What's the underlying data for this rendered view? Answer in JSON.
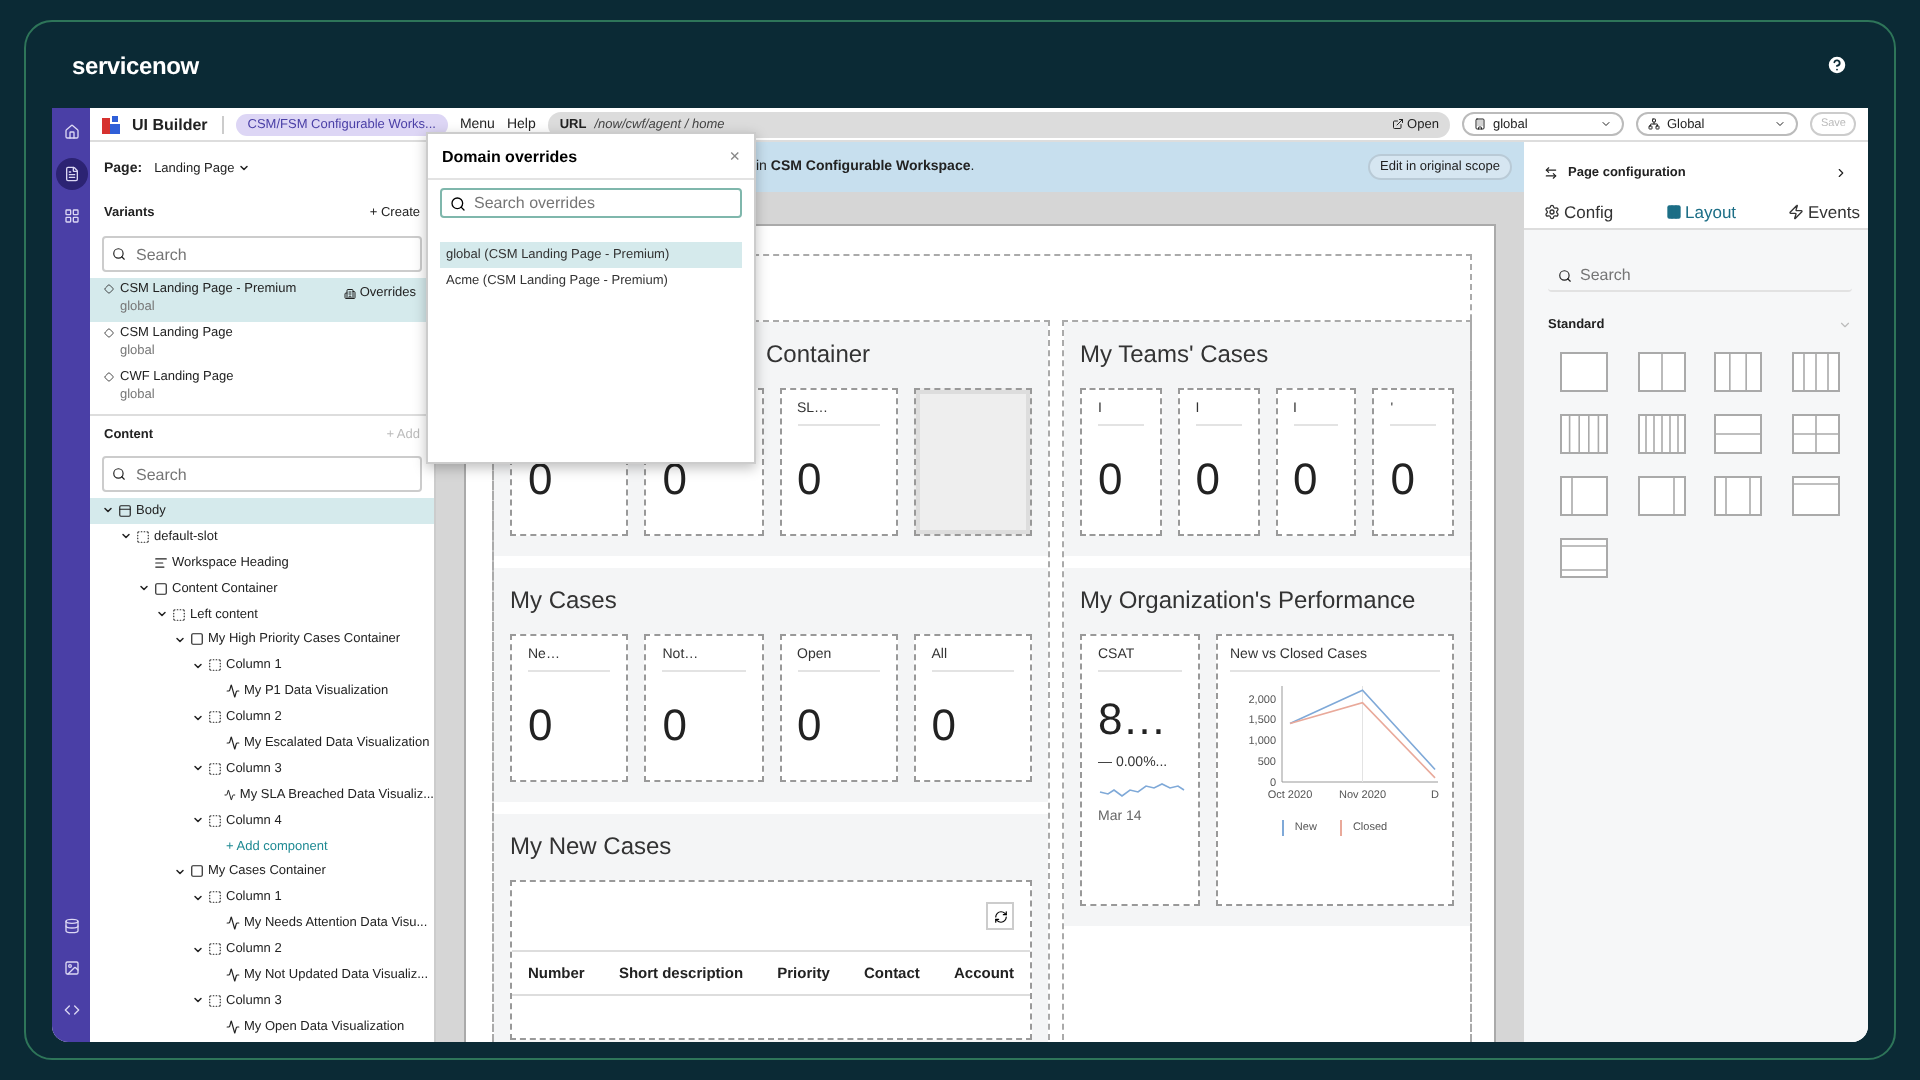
{
  "brand": {
    "name": "servicenow"
  },
  "rail": {
    "top": [
      {
        "kind": "home",
        "selected": false
      },
      {
        "kind": "page",
        "selected": true
      },
      {
        "kind": "components",
        "selected": false
      }
    ],
    "bottom": [
      {
        "kind": "data",
        "selected": false
      },
      {
        "kind": "media",
        "selected": false
      },
      {
        "kind": "code",
        "selected": false
      }
    ]
  },
  "topbar": {
    "app": "UI Builder",
    "experience": "CSM/FSM Configurable Works...",
    "menus": [
      "Menu",
      "Help"
    ],
    "url_label": "URL",
    "url": "/now/cwf/agent / home",
    "open": "Open",
    "scope": "global",
    "domain": "Global",
    "save": {
      "label": "Save",
      "disabled": true
    }
  },
  "left_panel": {
    "page_label": "Page:",
    "page": "Landing Page",
    "variants_title": "Variants",
    "create": "+ Create",
    "variant_search": {
      "placeholder": "Search"
    },
    "variants": [
      {
        "name": "CSM Landing Page - Premium",
        "scope": "global",
        "selected": true,
        "action": "Overrides"
      },
      {
        "name": "CSM Landing Page",
        "scope": "global",
        "selected": false
      },
      {
        "name": "CWF Landing Page",
        "scope": "global",
        "selected": false
      }
    ],
    "content_title": "Content",
    "add": {
      "label": "+ Add",
      "disabled": true
    },
    "content_search": {
      "placeholder": "Search"
    },
    "tree": [
      {
        "kind": "body",
        "label": "Body",
        "selected": true,
        "expanded": true,
        "children": [
          {
            "kind": "slot",
            "label": "default-slot",
            "selected": false,
            "expanded": true,
            "children": [
              {
                "kind": "heading",
                "label": "Workspace Heading",
                "selected": false
              },
              {
                "kind": "container",
                "label": "Content Container",
                "selected": false,
                "expanded": true,
                "children": [
                  {
                    "kind": "slot",
                    "label": "Left content",
                    "selected": false,
                    "expanded": true,
                    "children": [
                      {
                        "kind": "container",
                        "label": "My High Priority Cases Container",
                        "selected": false,
                        "expanded": true,
                        "children": [
                          {
                            "kind": "slot",
                            "label": "Column 1",
                            "selected": false,
                            "expanded": true,
                            "children": [
                              {
                                "kind": "viz",
                                "label": "My P1 Data Visualization",
                                "selected": false
                              }
                            ]
                          },
                          {
                            "kind": "slot",
                            "label": "Column 2",
                            "selected": false,
                            "expanded": true,
                            "children": [
                              {
                                "kind": "viz",
                                "label": "My Escalated Data Visualization",
                                "selected": false
                              }
                            ]
                          },
                          {
                            "kind": "slot",
                            "label": "Column 3",
                            "selected": false,
                            "expanded": true,
                            "children": [
                              {
                                "kind": "viz",
                                "label": "My SLA Breached Data Visualiz...",
                                "selected": false
                              }
                            ]
                          },
                          {
                            "kind": "slot",
                            "label": "Column 4",
                            "selected": false,
                            "expanded": true,
                            "children": [
                              {
                                "kind": "add",
                                "label": "+ Add component",
                                "selected": false
                              }
                            ]
                          }
                        ]
                      },
                      {
                        "kind": "container",
                        "label": "My Cases Container",
                        "selected": false,
                        "expanded": true,
                        "children": [
                          {
                            "kind": "slot",
                            "label": "Column 1",
                            "selected": false,
                            "expanded": true,
                            "children": [
                              {
                                "kind": "viz",
                                "label": "My Needs Attention Data Visu...",
                                "selected": false
                              }
                            ]
                          },
                          {
                            "kind": "slot",
                            "label": "Column 2",
                            "selected": false,
                            "expanded": true,
                            "children": [
                              {
                                "kind": "viz",
                                "label": "My Not Updated Data Visualiz...",
                                "selected": false
                              }
                            ]
                          },
                          {
                            "kind": "slot",
                            "label": "Column 3",
                            "selected": false,
                            "expanded": true,
                            "children": [
                              {
                                "kind": "viz",
                                "label": "My Open Data Visualization",
                                "selected": false
                              }
                            ]
                          }
                        ]
                      }
                    ]
                  }
                ]
              }
            ]
          }
        ]
      }
    ]
  },
  "popover": {
    "title": "Domain overrides",
    "close": "×",
    "search": {
      "placeholder": "Search overrides"
    },
    "items": [
      {
        "label": "global (CSM Landing Page - Premium)",
        "selected": true
      },
      {
        "label": "Acme (CSM Landing Page - Premium)",
        "selected": false
      }
    ]
  },
  "banner": {
    "text": "in **CSM Configurable Workspace**.",
    "action": "Edit in original scope"
  },
  "canvas": {
    "left": [
      {
        "title": "Container",
        "kind": "cards",
        "cards": [
          {
            "kind": "count",
            "value": "0"
          },
          {
            "kind": "count",
            "value": "0"
          },
          {
            "kind": "count",
            "label": "SL…",
            "value": "0"
          },
          {
            "kind": "empty"
          }
        ]
      },
      {
        "title": "My Cases",
        "kind": "cards",
        "cards": [
          {
            "kind": "count",
            "label": "Ne…",
            "value": "0"
          },
          {
            "kind": "count",
            "label": "Not…",
            "value": "0"
          },
          {
            "kind": "count",
            "label": "Open",
            "value": "0"
          },
          {
            "kind": "count",
            "label": "All",
            "value": "0"
          }
        ]
      },
      {
        "title": "My New Cases",
        "kind": "table",
        "columns": [
          "Number",
          "Short description",
          "Priority",
          "Contact",
          "Account"
        ]
      }
    ],
    "right": [
      {
        "title": "My Teams' Cases",
        "kind": "cards",
        "cards": [
          {
            "kind": "count",
            "label": "I",
            "value": "0"
          },
          {
            "kind": "count",
            "label": "I",
            "value": "0"
          },
          {
            "kind": "count",
            "label": "I",
            "value": "0"
          },
          {
            "kind": "count",
            "label": "'",
            "value": "0"
          }
        ]
      },
      {
        "title": "My Organization's Performance",
        "kind": "performance",
        "score": {
          "label": "CSAT",
          "value": "8…",
          "change": "— 0.00%...",
          "date": "Mar 14"
        },
        "chart": {
          "title": "New vs Closed Cases",
          "chart_data": {
            "type": "line",
            "categories": [
              "Oct 2020",
              "Nov 2020",
              "D"
            ],
            "ylim": [
              0,
              2300
            ],
            "yticks": [
              0,
              500,
              {
                "value": 1000,
                "label": "1,000"
              },
              {
                "value": 1500,
                "label": "1,500"
              },
              {
                "value": 2000,
                "label": "2,000"
              }
            ],
            "series": [
              {
                "name": "New",
                "color": "#7fa9d8",
                "values": [
                  1400,
                  2200,
                  300
                ]
              },
              {
                "name": "Closed",
                "color": "#e9a99a",
                "values": [
                  1400,
                  1900,
                  100
                ]
              }
            ]
          }
        }
      }
    ]
  },
  "right_panel": {
    "title": "Page configuration",
    "tabs": [
      {
        "label": "Config",
        "selected": false
      },
      {
        "label": "Layout",
        "selected": true
      },
      {
        "label": "Events",
        "selected": false
      }
    ],
    "search": {
      "placeholder": "Search"
    },
    "section": {
      "title": "Standard",
      "expanded": true
    }
  }
}
